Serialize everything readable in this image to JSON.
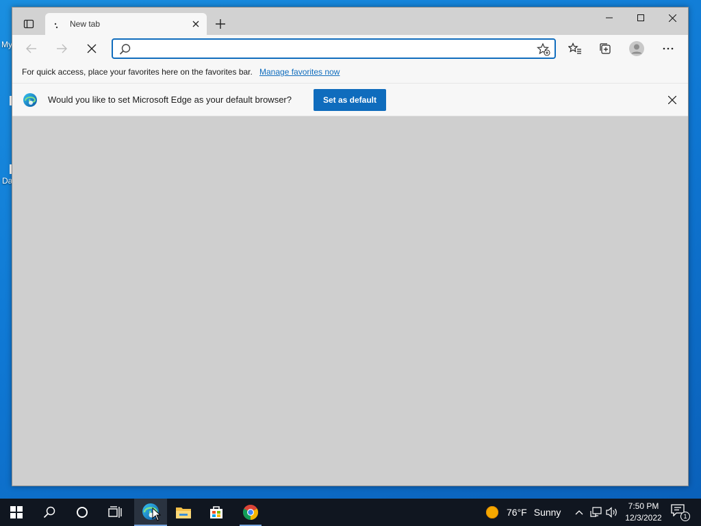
{
  "desktop": {
    "label_fragment_1": "My",
    "label_fragment_2": "Da"
  },
  "browser": {
    "tab": {
      "title": "New tab"
    },
    "address_bar": {
      "value": "",
      "placeholder": ""
    },
    "favorites_bar": {
      "message": "For quick access, place your favorites here on the favorites bar.",
      "link": "Manage favorites now"
    },
    "infobar": {
      "prompt": "Would you like to set Microsoft Edge as your default browser?",
      "button": "Set as default"
    },
    "page_state": "loading"
  },
  "taskbar": {
    "weather": {
      "temperature": "76°F",
      "condition": "Sunny"
    },
    "clock": {
      "time": "7:50 PM",
      "date": "12/3/2022"
    },
    "notification_count": "1",
    "pinned_apps": [
      "start",
      "search",
      "cortana",
      "task-view",
      "edge",
      "file-explorer",
      "microsoft-store",
      "chrome"
    ]
  },
  "colors": {
    "accent": "#0f6cbd",
    "desktop": "#0f78d4",
    "taskbar": "#101620",
    "window_content": "#cfcfcf"
  }
}
